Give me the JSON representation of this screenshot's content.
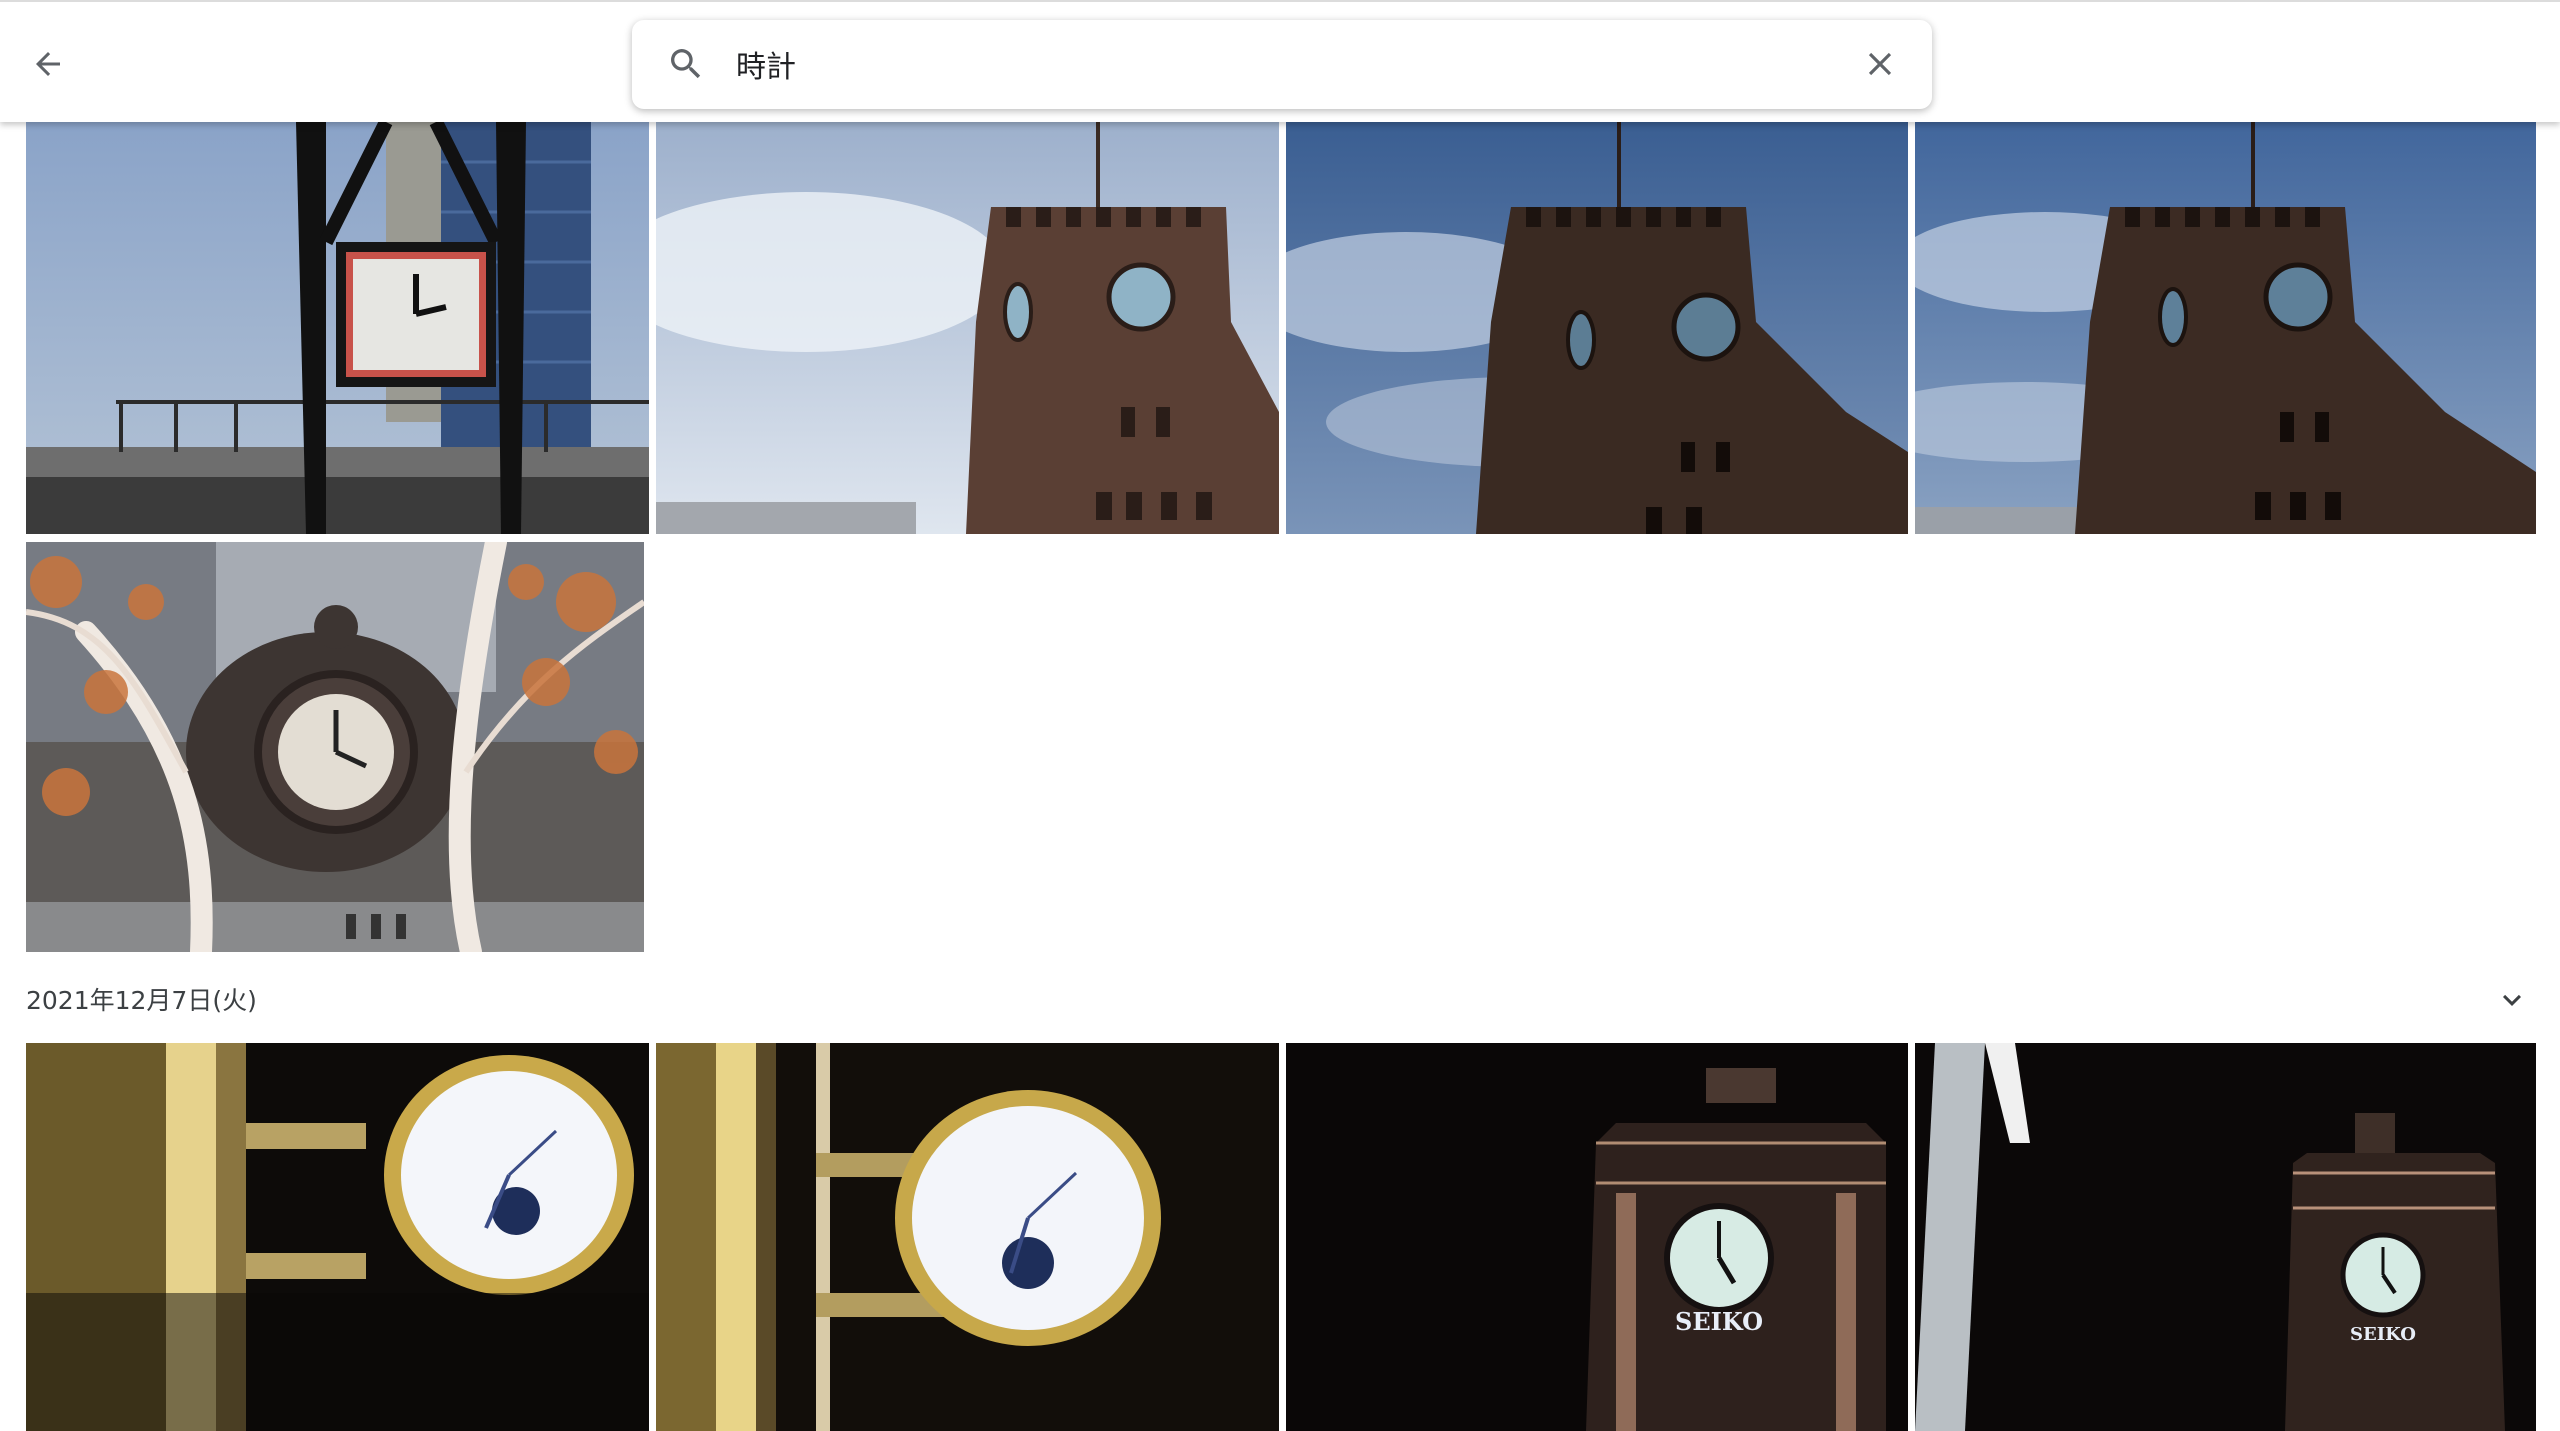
{
  "header": {
    "back_icon": "arrow-left-icon",
    "search": {
      "icon": "search-icon",
      "value": "時計",
      "clear_icon": "close-icon"
    }
  },
  "sections": [
    {
      "photos": [
        {
          "subject": "black steel clock tower frame with square clock"
        },
        {
          "subject": "brick clock tower, bright sky"
        },
        {
          "subject": "brick clock tower, blue cloudy sky"
        },
        {
          "subject": "brick clock tower, blue sky"
        },
        {
          "subject": "large ornate clock behind tree branches"
        }
      ]
    },
    {
      "date": "2021年12月7日(火)",
      "collapse_icon": "chevron-down-icon",
      "photos": [
        {
          "subject": "illuminated wall clock at night"
        },
        {
          "subject": "illuminated wall clock close-up"
        },
        {
          "subject": "SEIKO clock tower at night"
        },
        {
          "subject": "SEIKO clock tower at night with lamp post"
        }
      ]
    }
  ],
  "colors": {
    "accent_text": "#202124",
    "secondary_text": "#3c4043",
    "icon": "#5f6368"
  }
}
